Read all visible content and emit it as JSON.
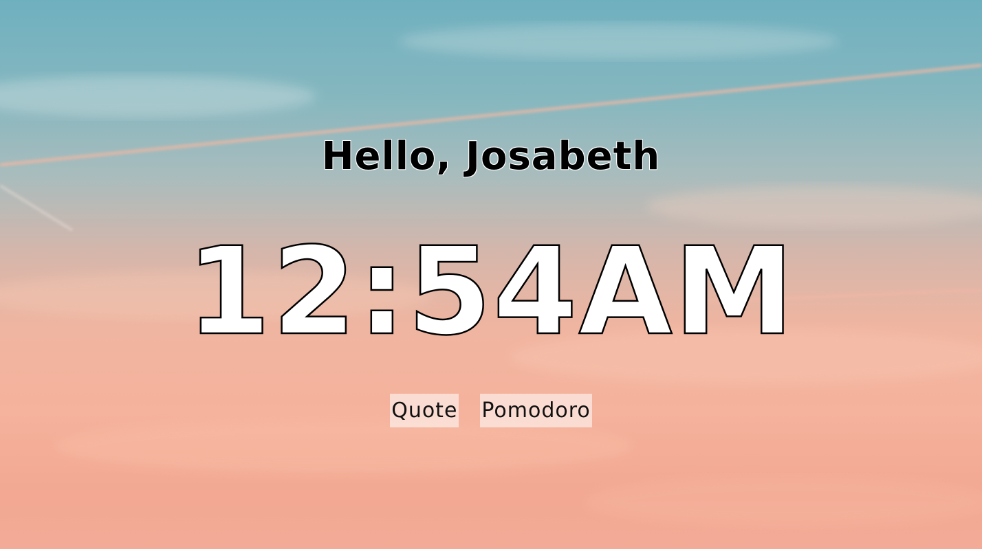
{
  "greeting": "Hello, Josabeth",
  "clock": {
    "time": "12:54AM"
  },
  "buttons": {
    "quote_label": "Quote",
    "pomodoro_label": "Pomodoro"
  },
  "colors": {
    "sky_top": "#6fb0bf",
    "sky_bottom": "#f3ab97",
    "clock_fill": "#ffffff",
    "clock_outline": "#000000",
    "button_bg": "rgba(255,255,255,0.55)"
  }
}
